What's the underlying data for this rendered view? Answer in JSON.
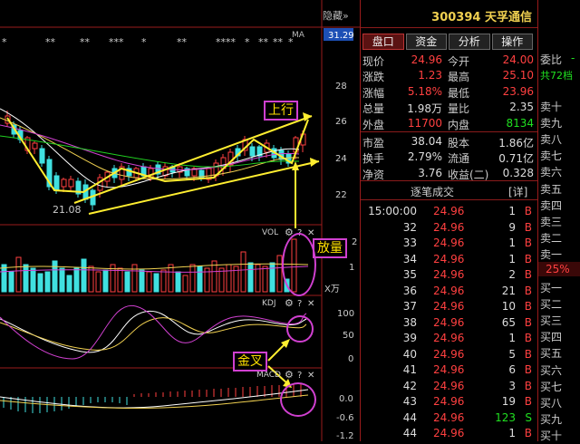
{
  "chart": {
    "hide_label": "隐藏»",
    "top_stars": [
      "**",
      "**",
      "***",
      "*",
      "**",
      "****",
      "*",
      "**",
      "**",
      "*"
    ],
    "ma_label": "MA",
    "price_current": "31.29",
    "price_ticks": [
      "28",
      "26",
      "24",
      "22"
    ],
    "low_label": "21.08",
    "vol_label": "VOL",
    "vol_ticks": [
      "2",
      "1"
    ],
    "vol_unit": "X万",
    "kdj_label": "KDJ",
    "kdj_ticks": [
      "100",
      "50",
      "0"
    ],
    "macd_label": "MACD",
    "macd_ticks": [
      "0.0",
      "-0.6",
      "-1.2"
    ],
    "annotations": {
      "up": "上行",
      "volume": "放量",
      "golden_cross": "金叉"
    }
  },
  "stock": {
    "code": "300394",
    "name": "天孚通信"
  },
  "tabs": [
    "盘口",
    "资金",
    "分析",
    "操作"
  ],
  "quote_rows": [
    {
      "l1": "现价",
      "v1": "24.96",
      "c1": "red",
      "l2": "今开",
      "v2": "24.00",
      "c2": "red"
    },
    {
      "l1": "涨跌",
      "v1": "1.23",
      "c1": "red",
      "l2": "最高",
      "v2": "25.10",
      "c2": "red"
    },
    {
      "l1": "涨幅",
      "v1": "5.18%",
      "c1": "red",
      "l2": "最低",
      "v2": "23.96",
      "c2": "red"
    },
    {
      "l1": "总量",
      "v1": "1.98万",
      "c1": "wht",
      "l2": "量比",
      "v2": "2.35",
      "c2": "wht"
    },
    {
      "l1": "外盘",
      "v1": "11700",
      "c1": "red",
      "l2": "内盘",
      "v2": "8134",
      "c2": "grn"
    }
  ],
  "info_rows": [
    {
      "l1": "市盈",
      "v1": "38.04",
      "l2": "股本",
      "v2": "1.86亿"
    },
    {
      "l1": "换手",
      "v1": "2.79%",
      "l2": "流通",
      "v2": "0.71亿"
    },
    {
      "l1": "净资",
      "v1": "3.76",
      "l2": "收益(二)",
      "v2": "0.328"
    }
  ],
  "trades_title": "逐笔成交",
  "trades_detail": "[详]",
  "trades": [
    {
      "time": "15:00:00",
      "price": "24.96",
      "vol": "1",
      "bs": "B",
      "vc": "wht",
      "bc": "red"
    },
    {
      "time": "32",
      "price": "24.96",
      "vol": "9",
      "bs": "B",
      "vc": "wht",
      "bc": "red"
    },
    {
      "time": "33",
      "price": "24.96",
      "vol": "1",
      "bs": "B",
      "vc": "wht",
      "bc": "red"
    },
    {
      "time": "34",
      "price": "24.96",
      "vol": "1",
      "bs": "B",
      "vc": "wht",
      "bc": "red"
    },
    {
      "time": "35",
      "price": "24.96",
      "vol": "2",
      "bs": "B",
      "vc": "wht",
      "bc": "red"
    },
    {
      "time": "36",
      "price": "24.96",
      "vol": "21",
      "bs": "B",
      "vc": "wht",
      "bc": "red"
    },
    {
      "time": "37",
      "price": "24.96",
      "vol": "10",
      "bs": "B",
      "vc": "wht",
      "bc": "red"
    },
    {
      "time": "38",
      "price": "24.96",
      "vol": "65",
      "bs": "B",
      "vc": "wht",
      "bc": "red"
    },
    {
      "time": "39",
      "price": "24.96",
      "vol": "1",
      "bs": "B",
      "vc": "wht",
      "bc": "red"
    },
    {
      "time": "40",
      "price": "24.96",
      "vol": "5",
      "bs": "B",
      "vc": "wht",
      "bc": "red"
    },
    {
      "time": "41",
      "price": "24.96",
      "vol": "6",
      "bs": "B",
      "vc": "wht",
      "bc": "red"
    },
    {
      "time": "42",
      "price": "24.96",
      "vol": "3",
      "bs": "B",
      "vc": "wht",
      "bc": "red"
    },
    {
      "time": "43",
      "price": "24.96",
      "vol": "19",
      "bs": "B",
      "vc": "wht",
      "bc": "red"
    },
    {
      "time": "44",
      "price": "24.96",
      "vol": "123",
      "bs": "S",
      "vc": "grn",
      "bc": "grn"
    },
    {
      "time": "44",
      "price": "24.96",
      "vol": "1",
      "bs": "B",
      "vc": "wht",
      "bc": "red"
    }
  ],
  "side": {
    "header": "委比",
    "tag": "共72档",
    "sells": [
      "卖十",
      "卖九",
      "卖八",
      "卖七",
      "卖六",
      "卖五",
      "卖四",
      "卖三",
      "卖二",
      "卖一"
    ],
    "ratio": "25%",
    "buys": [
      "买一",
      "买二",
      "买三",
      "买四",
      "买五",
      "买六",
      "买七",
      "买八",
      "买九",
      "买十"
    ]
  },
  "colors": {
    "accent_red": "#ff4040",
    "accent_green": "#20e020",
    "label_yellow": "#f0d050",
    "border": "#9a1b1b"
  }
}
